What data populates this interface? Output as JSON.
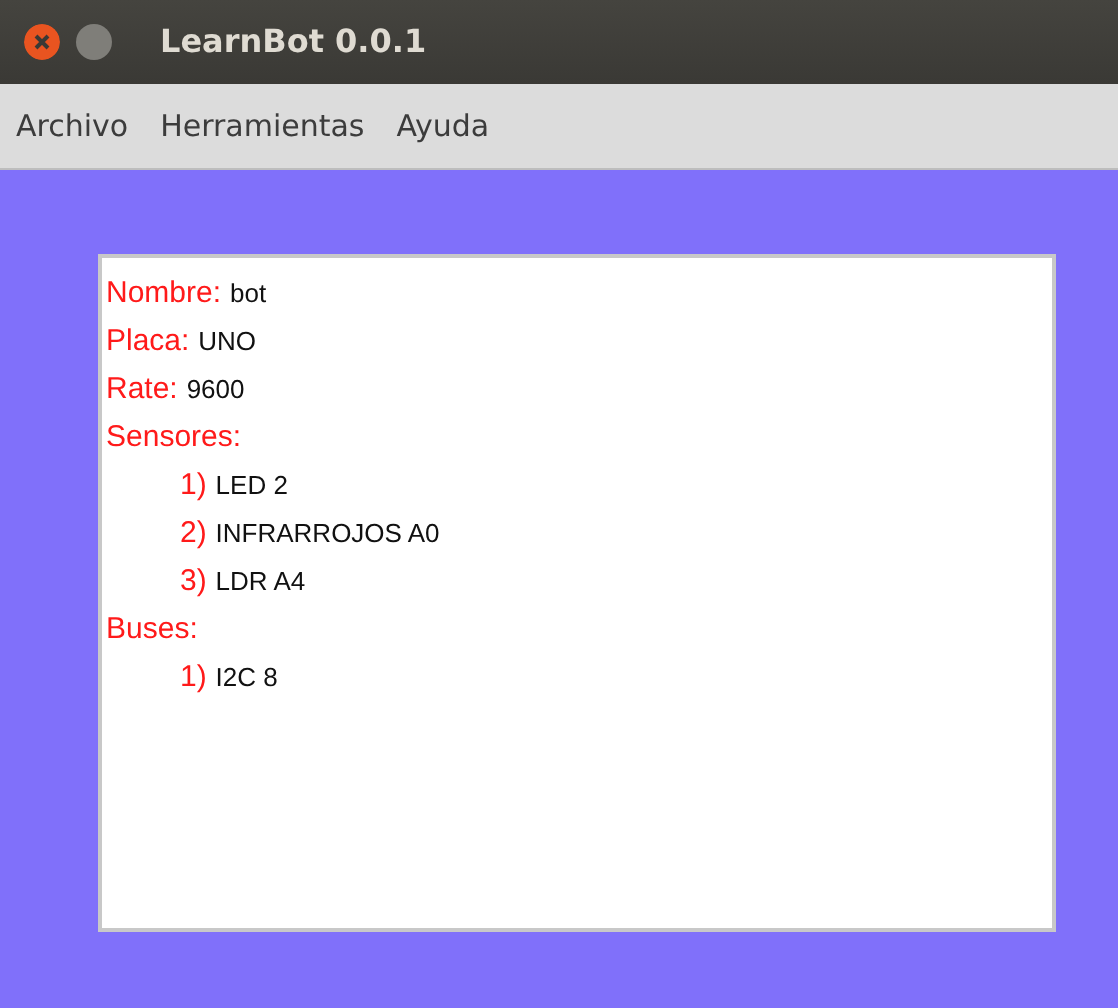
{
  "window": {
    "title": "LearnBot 0.0.1"
  },
  "menu": [
    "Archivo",
    "Herramientas",
    "Ayuda"
  ],
  "fields": [
    {
      "label": "Nombre:",
      "value": "bot"
    },
    {
      "label": "Placa:",
      "value": "UNO"
    },
    {
      "label": "Rate:",
      "value": "9600"
    }
  ],
  "lists": [
    {
      "label": "Sensores:",
      "items": [
        {
          "number": "1)",
          "text": "LED 2"
        },
        {
          "number": "2)",
          "text": "INFRARROJOS A0"
        },
        {
          "number": "3)",
          "text": "LDR A4"
        }
      ]
    },
    {
      "label": "Buses:",
      "items": [
        {
          "number": "1)",
          "text": "I2C 8"
        }
      ]
    }
  ]
}
